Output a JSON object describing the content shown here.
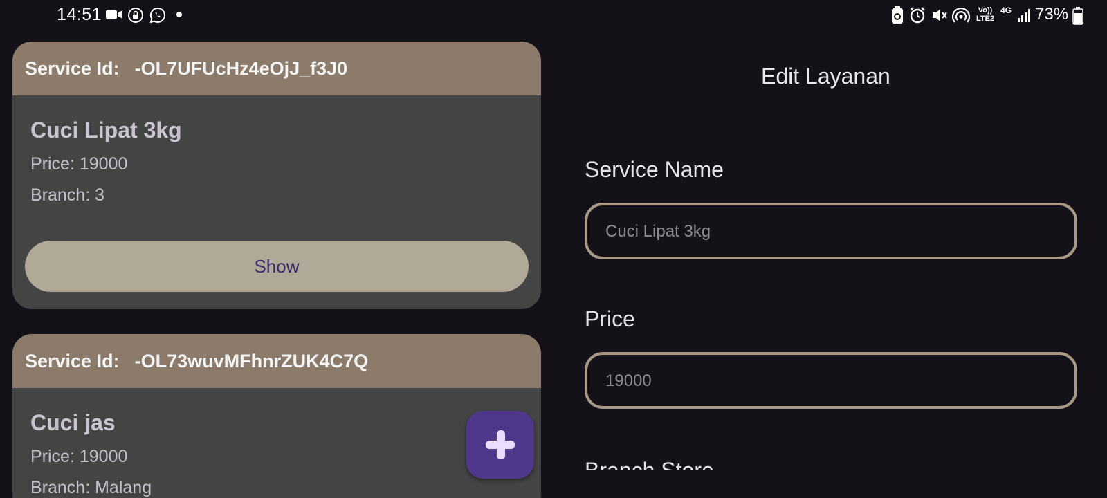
{
  "status_bar": {
    "time": "14:51",
    "left_icons": [
      "video-camera-icon",
      "lock-icon",
      "whatsapp-icon",
      "dot-icon"
    ],
    "right_icons": [
      "battery-saver-icon",
      "alarm-icon",
      "mute-icon",
      "hotspot-icon",
      "volte-icon",
      "4g-icon",
      "signal-icon",
      "battery-icon"
    ],
    "volte_text": "Vo)) LTE2",
    "network_text": "4G",
    "battery_text": "73%"
  },
  "services": [
    {
      "id_label": "Service Id:",
      "id_value": "-OL7UFUcHz4eOjJ_f3J0",
      "name": "Cuci Lipat 3kg",
      "price": "Price: 19000",
      "branch": "Branch: 3",
      "button_label": "Show"
    },
    {
      "id_label": "Service Id:",
      "id_value": "-OL73wuvMFhnrZUK4C7Q",
      "name": "Cuci jas",
      "price": "Price: 19000",
      "branch": "Branch: Malang"
    }
  ],
  "fab": {
    "icon": "plus-icon"
  },
  "form": {
    "title": "Edit Layanan",
    "service_name_label": "Service Name",
    "service_name_value": "Cuci Lipat 3kg",
    "price_label": "Price",
    "price_value": "19000",
    "branch_label": "Branch Store"
  },
  "colors": {
    "background": "#141218",
    "card": "#444444",
    "card_header": "#8c7b6a",
    "button": "#b1a998",
    "fab": "#4f378b",
    "field_border": "#a89a86"
  }
}
